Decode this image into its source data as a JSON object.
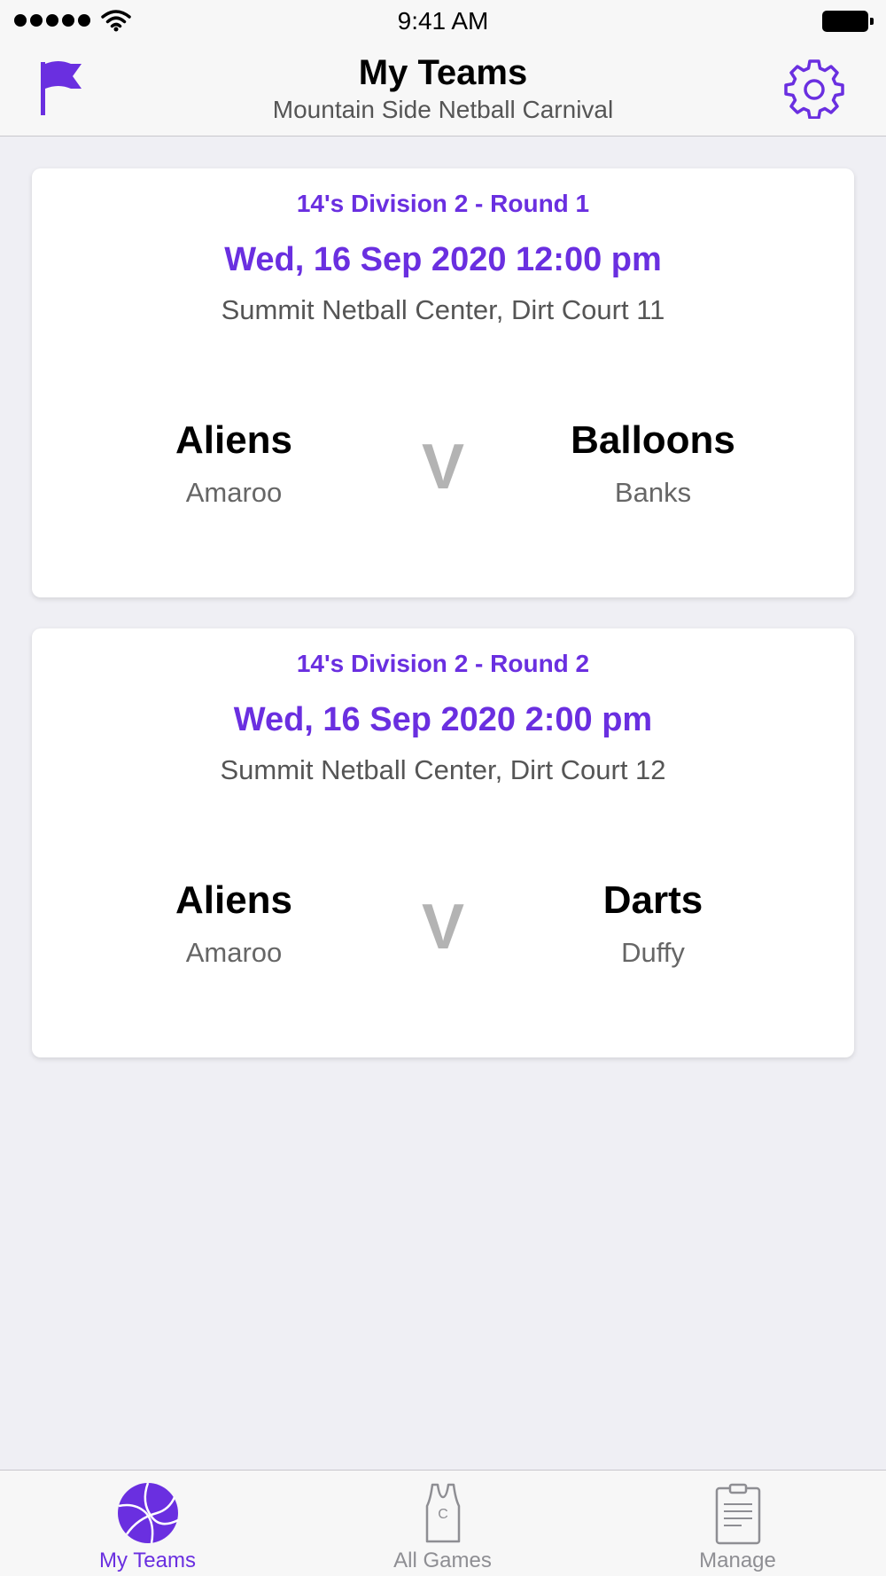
{
  "status_bar": {
    "time": "9:41 AM"
  },
  "header": {
    "title": "My Teams",
    "subtitle": "Mountain Side Netball Carnival",
    "left_icon": "flag-icon",
    "right_icon": "gear-icon"
  },
  "games": [
    {
      "division": "14's Division 2 - Round 1",
      "datetime": "Wed, 16 Sep 2020 12:00 pm",
      "venue": "Summit Netball Center, Dirt Court 11",
      "home": {
        "name": "Aliens",
        "club": "Amaroo"
      },
      "versus": "V",
      "away": {
        "name": "Balloons",
        "club": "Banks"
      }
    },
    {
      "division": "14's Division 2 - Round 2",
      "datetime": "Wed, 16 Sep 2020 2:00 pm",
      "venue": "Summit Netball Center, Dirt Court 12",
      "home": {
        "name": "Aliens",
        "club": "Amaroo"
      },
      "versus": "V",
      "away": {
        "name": "Darts",
        "club": "Duffy"
      }
    }
  ],
  "tabs": [
    {
      "label": "My Teams",
      "icon": "netball-icon",
      "active": true
    },
    {
      "label": "All Games",
      "icon": "bib-icon",
      "active": false
    },
    {
      "label": "Manage",
      "icon": "clipboard-icon",
      "active": false
    }
  ],
  "colors": {
    "accent": "#6a2fe0",
    "inactive": "#8e8e93",
    "background": "#efeff4"
  }
}
